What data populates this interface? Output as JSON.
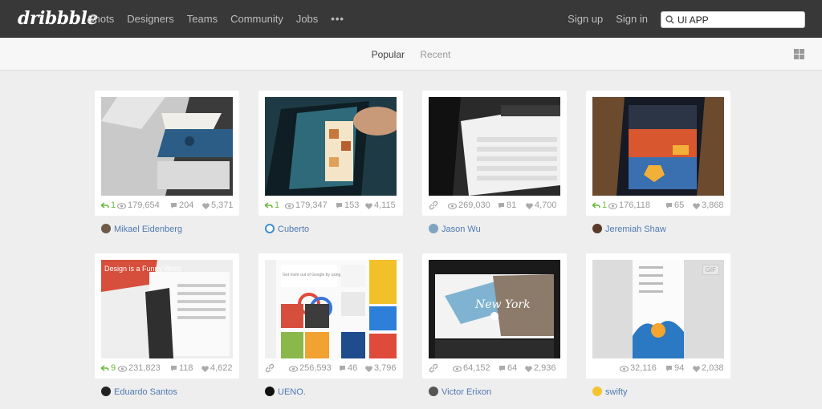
{
  "brand": {
    "logo": "dribbble"
  },
  "nav": {
    "items": [
      "Shots",
      "Designers",
      "Teams",
      "Community",
      "Jobs"
    ],
    "more": "•••"
  },
  "account": {
    "signup": "Sign up",
    "signin": "Sign in"
  },
  "search": {
    "value": "UI APP"
  },
  "filters": {
    "popular": "Popular",
    "recent": "Recent"
  },
  "shots": [
    {
      "rebounds": "1",
      "views": "179,654",
      "comments": "204",
      "likes": "5,371",
      "author": "Mikael Eidenberg"
    },
    {
      "rebounds": "1",
      "views": "179,347",
      "comments": "153",
      "likes": "4,115",
      "author": "Cuberto"
    },
    {
      "views": "269,030",
      "comments": "81",
      "likes": "4,700",
      "author": "Jason Wu"
    },
    {
      "rebounds": "1",
      "views": "176,118",
      "comments": "65",
      "likes": "3,868",
      "author": "Jeremiah Shaw"
    },
    {
      "rebounds": "9",
      "views": "231,823",
      "comments": "118",
      "likes": "4,622",
      "author": "Eduardo Santos",
      "thumb_text": "Design is a Funny Word"
    },
    {
      "views": "256,593",
      "comments": "46",
      "likes": "3,796",
      "author": "UENO.",
      "thumb_text": "Get more out of Google by using Google+"
    },
    {
      "views": "64,152",
      "comments": "64",
      "likes": "2,936",
      "author": "Victor Erixon",
      "thumb_text": "New York"
    },
    {
      "views": "32,116",
      "comments": "94",
      "likes": "2,038",
      "author": "swifty",
      "badge": "GIF"
    }
  ],
  "colors": {
    "topbar": "#383838",
    "link": "#4f7ab3",
    "rebound": "#6cbb3c"
  }
}
